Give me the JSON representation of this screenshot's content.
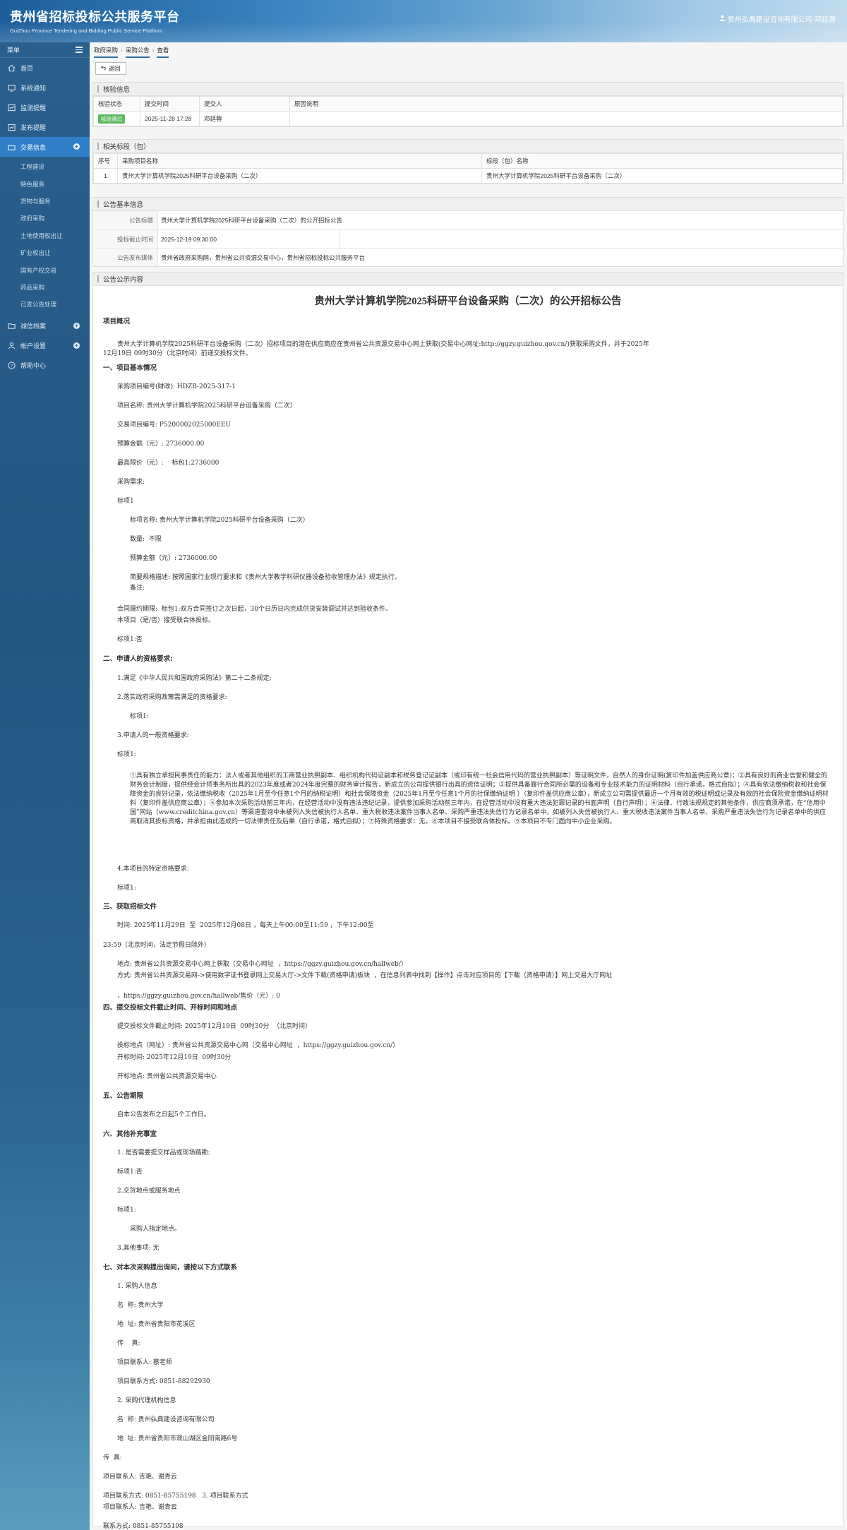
{
  "header": {
    "title_cn": "贵州省招标投标公共服务平台",
    "title_en": "GuiZhou Province Tendering and Bidding Public Service Platform",
    "user": "贵州弘典建设咨询有限公司-邓廷蓉"
  },
  "sidebar": {
    "title": "菜单",
    "items": [
      {
        "label": "首页",
        "icon": "home-icon"
      },
      {
        "label": "系统通知",
        "icon": "monitor-icon"
      },
      {
        "label": "监测提醒",
        "icon": "chart-icon"
      },
      {
        "label": "发布提醒",
        "icon": "chart-icon"
      },
      {
        "label": "交易信息",
        "icon": "folder-icon"
      }
    ],
    "sub_items": [
      "工程建设",
      "特色服务",
      "货物与服务",
      "政府采购",
      "土地使用权出让",
      "矿业权出让",
      "国有产权交易",
      "药品采购",
      "已发公告处理"
    ],
    "bottom_items": [
      {
        "label": "诚信档案",
        "icon": "folder-icon"
      },
      {
        "label": "帐户设置",
        "icon": "user-icon"
      },
      {
        "label": "帮助中心",
        "icon": "help-icon"
      }
    ]
  },
  "breadcrumb": [
    "政府采购",
    "采购公告",
    "查看"
  ],
  "back_label": "返回",
  "verify": {
    "title": "核验信息",
    "headers": [
      "核验状态",
      "提交时间",
      "提交人",
      "原因说明"
    ],
    "row": {
      "status": "核验通过",
      "time": "2025-11-28 17:28",
      "person": "邓廷蓉",
      "reason": ""
    }
  },
  "sections": {
    "title": "相关标段（包）",
    "headers": [
      "序号",
      "采购项目名称",
      "标段（包）名称"
    ],
    "rows": [
      {
        "no": "1",
        "project": "贵州大学计算机学院2025科研平台设备采购（二次）",
        "section": "贵州大学计算机学院2025科研平台设备采购（二次）"
      }
    ]
  },
  "basic": {
    "title": "公告基本信息",
    "rows": [
      {
        "label": "公告标题",
        "value": "贵州大学计算机学院2025科研平台设备采购（二次）的公开招标公告"
      },
      {
        "label": "投标截止时间",
        "value": "2025-12-19 09:30:00"
      },
      {
        "label": "公告发布媒体",
        "value": "贵州省政府采购网，贵州省公共资源交易中心，贵州省招标投标公共服务平台"
      }
    ]
  },
  "content": {
    "panel_title": "公告公示内容",
    "doc_title": "贵州大学计算机学院2025科研平台设备采购（二次）的公开招标公告",
    "lines": [
      {
        "t": "项目概况",
        "b": true
      },
      {
        "t": "贵州大学计算机学院2025科研平台设备采购（二次）招标项目的潜在供应商应在贵州省公共资源交易中心网上获取(交易中心网址:http://ggzy.guizhou.gov.cn/)获取采购文件，并于2025年"
      },
      {
        "t": "12月19日 09时30分（北京时间）前递交投标文件。"
      },
      {
        "t": "一、项目基本情况",
        "b": true
      },
      {
        "t": "采购项目编号(财政): HDZB-2025-317-1"
      },
      {
        "t": "项目名称: 贵州大学计算机学院2025科研平台设备采购（二次）"
      },
      {
        "t": "交易项目编号: P5200002025000EEU"
      },
      {
        "t": "预算金额（元）: 2736000.00"
      },
      {
        "t": "最高限价（元）:    标包1:2736000"
      },
      {
        "t": "采购需求:"
      },
      {
        "t": "标项1"
      },
      {
        "t": "标项名称: 贵州大学计算机学院2025科研平台设备采购（二次）"
      },
      {
        "t": "数量:  不限"
      },
      {
        "t": "预算金额（元）: 2736000.00"
      },
      {
        "t": "简要规格描述: 按照国家行业现行要求和《贵州大学教学科研仪器设备验收管理办法》规定执行。"
      },
      {
        "t": "备注:"
      },
      {
        "t": "合同履约期限:  标包1:双方合同签订之次日起，30个日历日内完成供货安装调试并达到验收条件。"
      },
      {
        "t": "本项目（是/否）接受联合体投标。"
      },
      {
        "t": "标项1:否"
      },
      {
        "t": "二、申请人的资格要求:",
        "b": true
      },
      {
        "t": "1.满足《中华人民共和国政府采购法》第二十二条规定;"
      },
      {
        "t": "2.落实政府采购政策需满足的资格要求:"
      },
      {
        "t": "标项1:"
      },
      {
        "t": "3.申请人的一般资格要求:"
      },
      {
        "t": "标项1:"
      },
      {
        "t": "①具有独立承担民事责任的能力：法人或者其他组织的工商营业执照副本、组织机构代码证副本和税务登记证副本（或印有统一社会信用代码的营业执照副本）等证明文件，自然人的身份证明(复印件加盖供应商公章)；②具有良好的商业信誉和健全的财务会计制度，提供经会计师事务所出具的2023年度或者2024年度完整的财务审计报告，新成立的公司提供银行出具的资信证明；③提供具备履行合同所必需的设备和专业技术能力的证明材料（自行承诺，格式自拟）；④具有依法缴纳税收和社会保障资金的良好记录，依法缴纳税收（2025年1月至今任意1个月的纳税证明）和社会保障资金（2025年1月至今任意1个月的社保缴纳证明  ）（复印件盖供应商公章），新成立公司需提供最近一个月有效的税证明或记录及有效的社会保险资金缴纳证明材料（复印件盖供应商公章）；⑤参加本次采购活动前三年内，在经营活动中没有违法违纪记录，提供参加采购活动前三年内，在经营活动中没有重大违法犯罪记录的书面声明（自行声明）；⑥法律、行政法规规定的其他条件，供应商须承诺，在“信用中国”网站（www.creditchina.gov.cn）等渠道查询中未被列入失信被执行人名单、重大税收违法案件当事人名单、采购严重违法失信行为记录名单中。如被列入失信被执行人、重大税收违法案件当事人名单、采购严重违法失信行为记录名单中的供应商取消其投标资格，并承担由此造成的一切法律责任及后果（自行承诺，格式自拟）；⑦特殊资格要求：无。⑧本项目不接受联合体投标。⑨本项目不专门面向中小企业采购。"
      },
      {
        "t": "4.本项目的特定资格要求:"
      },
      {
        "t": "标项1:"
      },
      {
        "t": "三、获取招标文件",
        "b": true
      },
      {
        "t": "时间: 2025年11月29日  至  2025年12月08日 ，每天上午00:00至11:59 ，下午12:00至"
      },
      {
        "t": "23:59（北京时间，法定节假日除外）"
      },
      {
        "t": "地点: 贵州省公共资源交易中心网上获取（交易中心网址  ，https://ggzy.guizhou.gov.cn/hallweb/）"
      },
      {
        "t": "方式: 贵州省公共资源交易网->使用数字证书登录网上交易大厅->文件下载(资格申请)板块  ，在信息列表中找到【操作】点击对应项目的【下载（资格申请）】网上交易大厅网址"
      },
      {
        "t": "，https://ggzy.guizhou.gov.cn/hallweb/售价（元）: 0"
      },
      {
        "t": "四、提交投标文件截止时间、开标时间和地点",
        "b": true
      },
      {
        "t": "提交投标文件截止时间: 2025年12月19日  09时30分  （北京时间）"
      },
      {
        "t": "投标地点（网址）: 贵州省公共资源交易中心网（交易中心网址  ，https://ggzy.guizhou.gov.cn/）"
      },
      {
        "t": "开标时间: 2025年12月19日  09时30分"
      },
      {
        "t": "开标地点: 贵州省公共资源交易中心"
      },
      {
        "t": "五、公告期限",
        "b": true
      },
      {
        "t": "自本公告发布之日起5个工作日。"
      },
      {
        "t": "六、其他补充事宜",
        "b": true
      },
      {
        "t": "1. 是否需要提交样品或现场踏勘:"
      },
      {
        "t": "标项1:否"
      },
      {
        "t": "2.交货地点或服务地点"
      },
      {
        "t": "标项1:"
      },
      {
        "t": "采购人指定地点。"
      },
      {
        "t": "3.其他事项: 无"
      },
      {
        "t": "七、对本次采购提出询问，请按以下方式联系",
        "b": true
      },
      {
        "t": "1. 采购人信息"
      },
      {
        "t": "名  称: 贵州大学"
      },
      {
        "t": "地  址: 贵州省贵阳市花溪区"
      },
      {
        "t": "传    真:"
      },
      {
        "t": "项目联系人: 蔡老师"
      },
      {
        "t": "项目联系方式: 0851-88292930"
      },
      {
        "t": "2. 采购代理机构信息"
      },
      {
        "t": "名  称: 贵州弘典建设咨询有限公司"
      },
      {
        "t": "地  址: 贵州省贵阳市观山湖区金阳南路6号"
      },
      {
        "t": "传  真:"
      },
      {
        "t": "项目联系人: 吉艳、谢青云"
      },
      {
        "t": "项目联系方式: 0851-85755198   3. 项目联系方式"
      },
      {
        "t": "项目联系人: 吉艳、谢青云"
      },
      {
        "t": "联系方式: 0851-85755198"
      }
    ]
  }
}
